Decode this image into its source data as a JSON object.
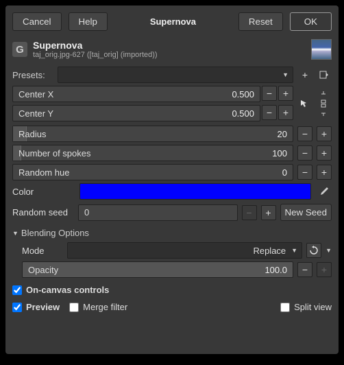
{
  "buttons": {
    "cancel": "Cancel",
    "help": "Help",
    "reset": "Reset",
    "ok": "OK"
  },
  "title": "Supernova",
  "header": {
    "title": "Supernova",
    "subtitle": "taj_orig.jpg-627 ([taj_orig] (imported))"
  },
  "presets_label": "Presets:",
  "fields": {
    "center_x": {
      "label": "Center X",
      "value": "0.500"
    },
    "center_y": {
      "label": "Center Y",
      "value": "0.500"
    },
    "radius": {
      "label": "Radius",
      "value": "20"
    },
    "spokes": {
      "label": "Number of spokes",
      "value": "100"
    },
    "random_hue": {
      "label": "Random hue",
      "value": "0"
    }
  },
  "color": {
    "label": "Color",
    "value": "#0000ff"
  },
  "random_seed": {
    "label": "Random seed",
    "value": "0",
    "new_seed": "New Seed"
  },
  "blending": {
    "title": "Blending Options",
    "mode_label": "Mode",
    "mode_value": "Replace",
    "opacity_label": "Opacity",
    "opacity_value": "100.0"
  },
  "checks": {
    "on_canvas": "On-canvas controls",
    "preview": "Preview",
    "merge": "Merge filter",
    "split": "Split view"
  }
}
